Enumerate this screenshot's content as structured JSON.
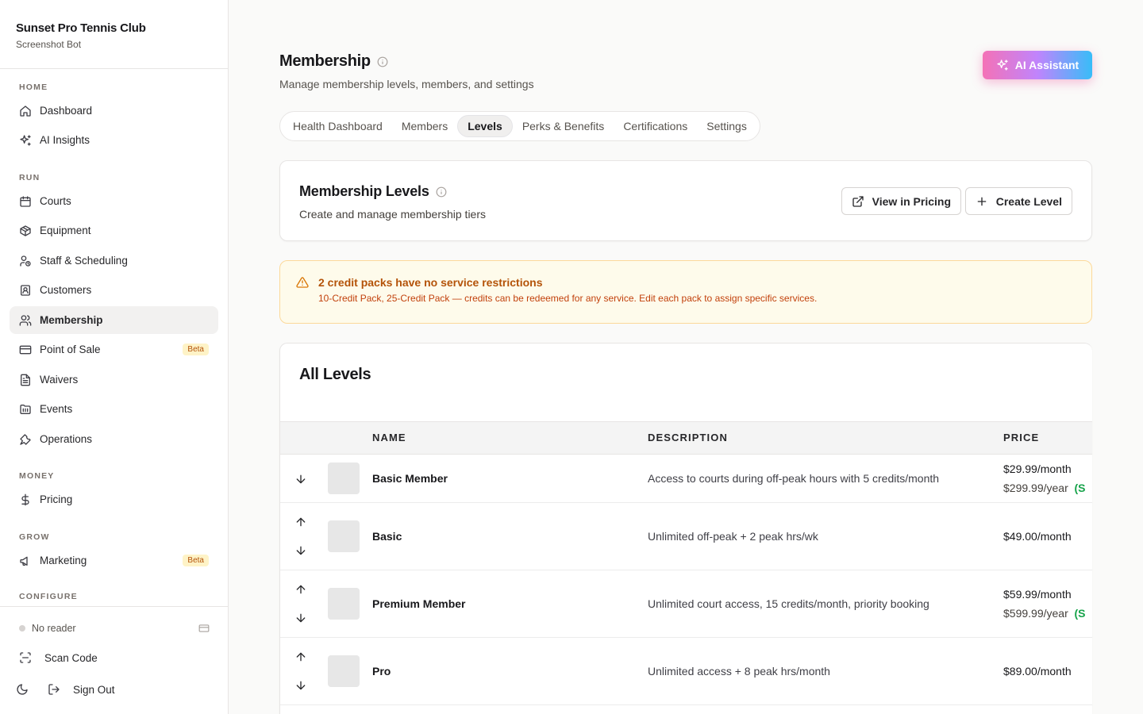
{
  "app": {
    "name": "Sunset Pro Tennis Club",
    "user": "Screenshot Bot"
  },
  "sidebar": {
    "sections": {
      "home": "HOME",
      "run": "RUN",
      "money": "MONEY",
      "grow": "GROW",
      "configure": "CONFIGURE"
    },
    "items": {
      "dashboard": "Dashboard",
      "ai_insights": "AI Insights",
      "courts": "Courts",
      "equipment": "Equipment",
      "staff": "Staff & Scheduling",
      "customers": "Customers",
      "membership": "Membership",
      "pos": "Point of Sale",
      "waivers": "Waivers",
      "events": "Events",
      "operations": "Operations",
      "pricing": "Pricing",
      "marketing": "Marketing"
    },
    "beta_label": "Beta",
    "active_item": "Membership",
    "footer": {
      "reader": "No reader",
      "scan": "Scan Code",
      "sign_out": "Sign Out"
    }
  },
  "page": {
    "title": "Membership",
    "subtitle": "Manage membership levels, members, and settings",
    "ai_button": "AI Assistant",
    "tabs": [
      "Health Dashboard",
      "Members",
      "Levels",
      "Perks & Benefits",
      "Certifications",
      "Settings"
    ],
    "active_tab": "Levels"
  },
  "levels_header": {
    "title": "Membership Levels",
    "subtitle": "Create and manage membership tiers",
    "view_pricing": "View in Pricing",
    "create_level": "Create Level"
  },
  "alert": {
    "title": "2 credit packs have no service restrictions",
    "body": "10-Credit Pack, 25-Credit Pack — credits can be redeemed for any service. Edit each pack to assign specific services."
  },
  "table": {
    "title": "All Levels",
    "columns": {
      "name": "NAME",
      "description": "DESCRIPTION",
      "price": "PRICE"
    },
    "rows": [
      {
        "name": "Basic Member",
        "description": "Access to courts during off-peak hours with 5 credits/month",
        "price_month": "$29.99/month",
        "price_year": "$299.99/year",
        "save": "(S"
      },
      {
        "name": "Basic",
        "description": "Unlimited off-peak + 2 peak hrs/wk",
        "price_month": "$49.00/month"
      },
      {
        "name": "Premium Member",
        "description": "Unlimited court access, 15 credits/month, priority booking",
        "price_month": "$59.99/month",
        "price_year": "$599.99/year",
        "save": "(S"
      },
      {
        "name": "Pro",
        "description": "Unlimited access + 8 peak hrs/month",
        "price_month": "$89.00/month"
      }
    ]
  },
  "colors": {
    "accent_gradient_start": "#f472b6",
    "accent_gradient_end": "#38bdf8",
    "alert_text": "#b45309",
    "save_green": "#16a34a"
  }
}
